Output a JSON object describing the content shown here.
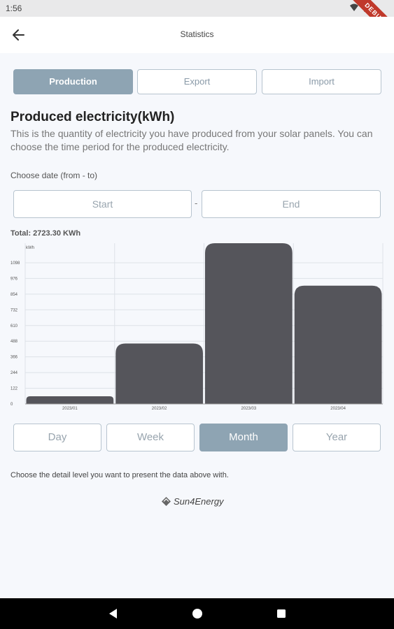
{
  "status": {
    "time": "1:56"
  },
  "debug_banner": "DEBUG",
  "app_bar": {
    "title": "Statistics"
  },
  "tabs": [
    {
      "label": "Production",
      "active": true
    },
    {
      "label": "Export",
      "active": false
    },
    {
      "label": "Import",
      "active": false
    }
  ],
  "section": {
    "heading": "Produced electricity(kWh)",
    "description": "This is the quantity of electricity you have produced from your solar panels. You can choose the time period for the  produced electricity."
  },
  "date_picker": {
    "label": "Choose date (from - to)",
    "start": "Start",
    "separator": "-",
    "end": "End"
  },
  "total": "Total: 2723.30 KWh",
  "chart_data": {
    "type": "bar",
    "ylabel": "kWh",
    "categories": [
      "2023/01",
      "2023/02",
      "2023/03",
      "2023/04"
    ],
    "values": [
      60,
      470,
      1250,
      920
    ],
    "yticks": [
      0,
      122,
      244,
      366,
      488,
      610,
      732,
      854,
      976,
      1098
    ],
    "ylim": [
      0,
      1250
    ],
    "grid": true,
    "bar_color": "#55555b"
  },
  "periods": [
    {
      "label": "Day",
      "active": false
    },
    {
      "label": "Week",
      "active": false
    },
    {
      "label": "Month",
      "active": true
    },
    {
      "label": "Year",
      "active": false
    }
  ],
  "detail_note": "Choose the detail level you want to present the data above with.",
  "logo": {
    "text": "Sun4Energy"
  },
  "colors": {
    "accent": "#8ea4b3",
    "border": "#b7c4cf",
    "background": "#f6f8fc"
  }
}
